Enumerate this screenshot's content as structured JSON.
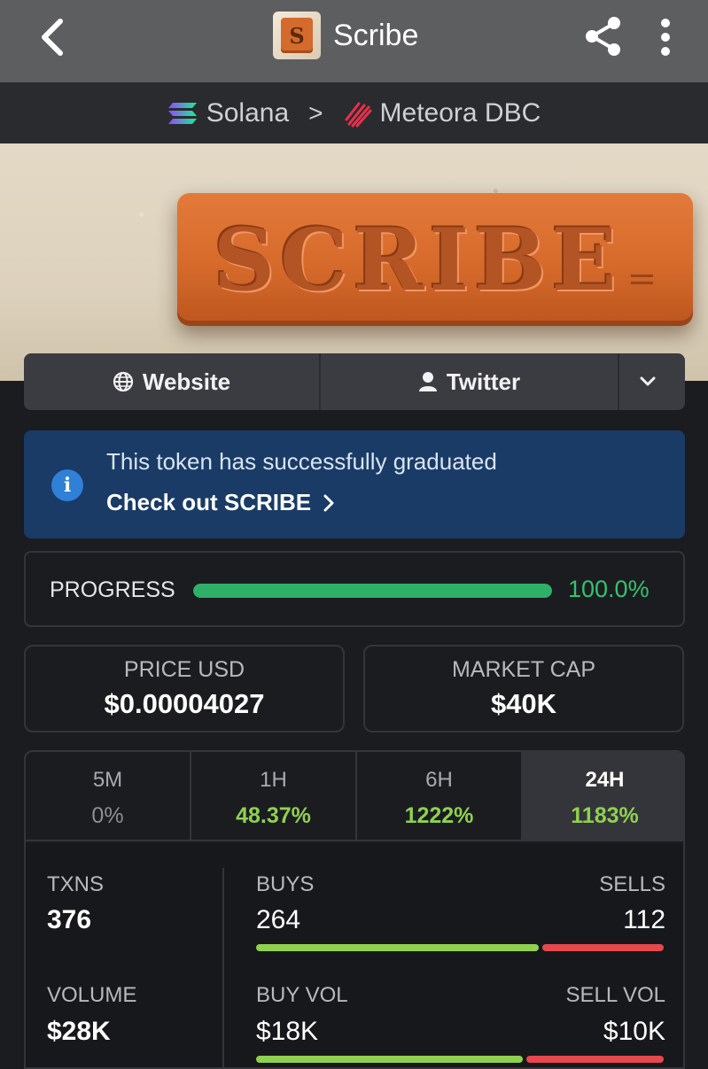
{
  "header": {
    "title": "Scribe",
    "logo_letter": "S",
    "icons": [
      "back-icon",
      "share-icon",
      "more-vertical-icon"
    ]
  },
  "breadcrumb": {
    "chain": "Solana",
    "separator": ">",
    "dex": "Meteora DBC"
  },
  "banner": {
    "text": "SCRIBE",
    "mark": "="
  },
  "links": {
    "website": "Website",
    "twitter": "Twitter"
  },
  "notice": {
    "message": "This token has successfully graduated",
    "cta": "Check out SCRIBE"
  },
  "progress": {
    "label": "PROGRESS",
    "percent": 100.0,
    "display": "100.0%"
  },
  "stats": {
    "price_label": "PRICE USD",
    "price_value": "$0.00004027",
    "mcap_label": "MARKET CAP",
    "mcap_value": "$40K"
  },
  "timeframes": [
    {
      "label": "5M",
      "value": "0%",
      "active": false
    },
    {
      "label": "1H",
      "value": "48.37%",
      "active": false
    },
    {
      "label": "6H",
      "value": "1222%",
      "active": false
    },
    {
      "label": "24H",
      "value": "1183%",
      "active": true
    }
  ],
  "txns": {
    "txns_label": "TXNS",
    "txns_value": "376",
    "buys_label": "BUYS",
    "buys_value": "264",
    "sells_label": "SELLS",
    "sells_value": "112",
    "volume_label": "VOLUME",
    "volume_value": "$28K",
    "buy_vol_label": "BUY VOL",
    "buy_vol_value": "$18K",
    "sell_vol_label": "SELL VOL",
    "sell_vol_value": "$10K",
    "buy_share": 0.7,
    "buy_vol_share": 0.66
  },
  "colors": {
    "up": "#8fd14f",
    "down": "#e5484d",
    "progress": "#2fb068",
    "notice_bg": "#193b66"
  }
}
